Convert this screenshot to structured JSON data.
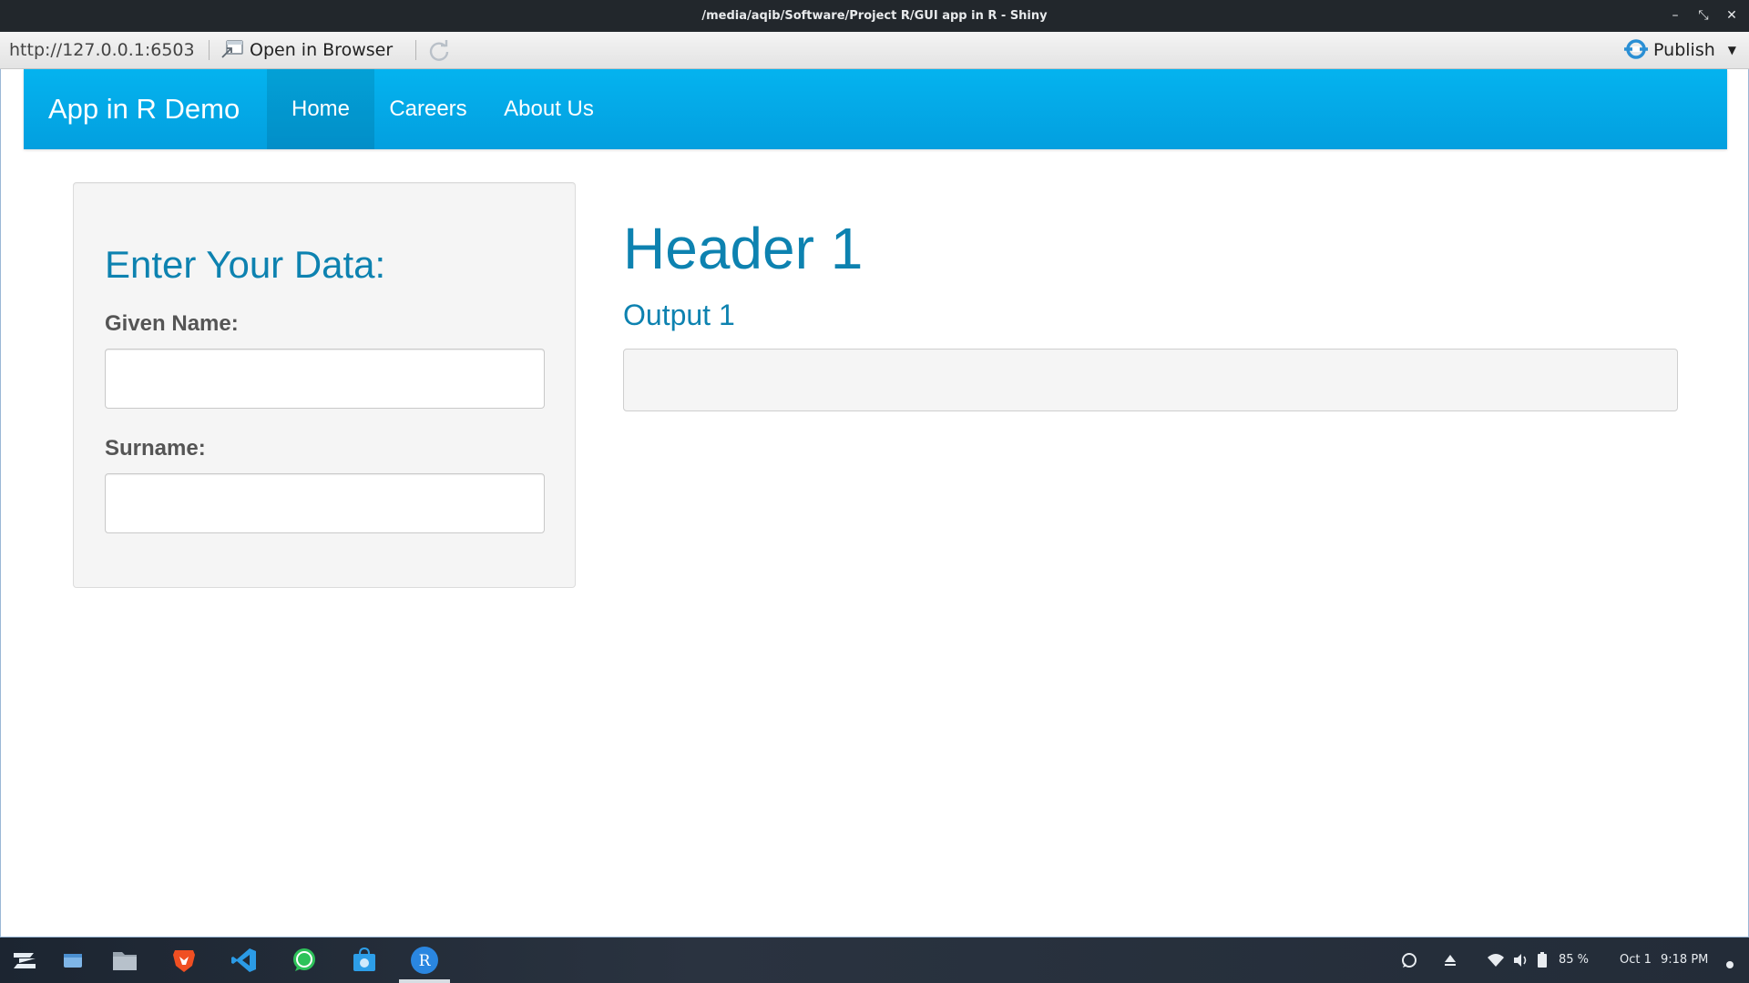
{
  "window": {
    "title": "/media/aqib/Software/Project R/GUI app in R - Shiny",
    "controls": {
      "minimize": "–",
      "restore": "⤡",
      "close": "✕"
    }
  },
  "toolbar": {
    "url": "http://127.0.0.1:6503",
    "open_in_browser_label": "Open in Browser",
    "publish_label": "Publish",
    "publish_caret": "▼",
    "icons": {
      "open": "open-in-browser-icon",
      "refresh": "refresh-icon",
      "publish": "publish-icon"
    }
  },
  "navbar": {
    "brand": "App in R Demo",
    "items": [
      {
        "label": "Home",
        "active": true
      },
      {
        "label": "Careers",
        "active": false
      },
      {
        "label": "About Us",
        "active": false
      }
    ],
    "color": "#04b3ef"
  },
  "sidebar": {
    "heading": "Enter Your Data:",
    "fields": [
      {
        "label": "Given Name:",
        "value": "",
        "placeholder": ""
      },
      {
        "label": "Surname:",
        "value": "",
        "placeholder": ""
      }
    ]
  },
  "main": {
    "header": "Header 1",
    "subheader": "Output 1",
    "output_text": ""
  },
  "taskbar": {
    "apps": [
      "zorin-menu-icon",
      "files-icon",
      "file-manager-icon",
      "brave-icon",
      "vscode-icon",
      "whatsapp-icon",
      "store-icon",
      "r-icon"
    ],
    "tray": {
      "battery": "85 %",
      "date": "Oct 1",
      "time": "9:18 PM"
    }
  },
  "colors": {
    "accent": "#0d82b0",
    "navbar": "#04b3ef",
    "titlebar": "#22272c"
  }
}
